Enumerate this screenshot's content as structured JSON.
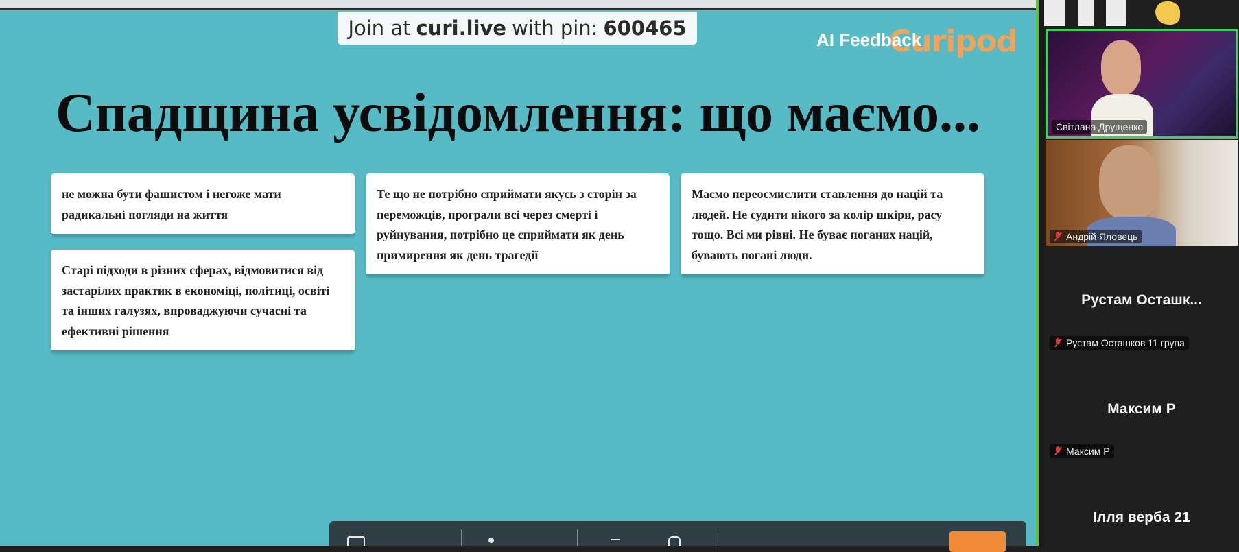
{
  "slide": {
    "join_prefix": "Join at",
    "join_site": "curi.live",
    "join_middle": "with pin:",
    "join_pin": "600465",
    "brand": "Curipod",
    "title": "Спадщина усвідомлення: що маємо...",
    "cards": [
      "не можна бути фашистом і негоже мати радикальні погляди на життя",
      "Старі підходи в різних сферах, відмовитися від застарілих практик в економіці, політиці, освіті та інших галузях, впроваджуючи сучасні та ефективні рішення",
      "Те що не потрібно сприймати якусь з сторін за переможців, програли всі через смерті і руйнування, потрібно це сприймати як день примирення як день трагедії",
      "Маємо переосмислити ставлення до націй та людей. Не судити нікого за колір шкіри, расу тощо. Всі ми рівні. Не буває поганих націй, бувають погані люди."
    ],
    "bottom_label": "AI Feedback"
  },
  "participants": [
    {
      "name": "Світлана Друщенко",
      "muted": false,
      "video": true,
      "active": true
    },
    {
      "name": "Андрій Яловець",
      "muted": true,
      "video": true,
      "active": false
    },
    {
      "display": "Рустам  Осташк...",
      "name": "Рустам Осташков 11 група",
      "muted": true,
      "video": false
    },
    {
      "display": "Максим Р",
      "name": "Максим Р",
      "muted": true,
      "video": false
    },
    {
      "display": "Ілля верба 21",
      "video": false
    }
  ],
  "colors": {
    "slide_bg": "#57bbc6",
    "brand": "#f0a35a",
    "active_border": "#3fcf5a",
    "muted_icon": "#e23c3c",
    "panel_bg": "#1f1f1f"
  }
}
